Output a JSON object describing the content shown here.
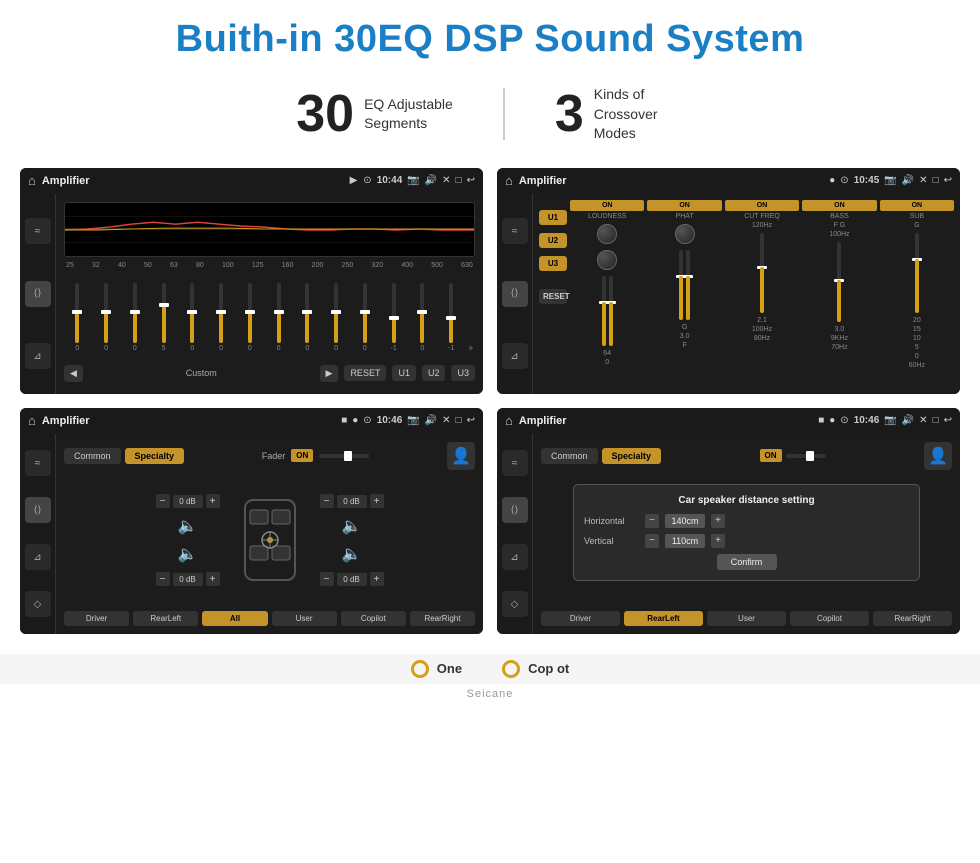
{
  "header": {
    "title": "Buith-in 30EQ DSP Sound System"
  },
  "stats": [
    {
      "number": "30",
      "label": "EQ Adjustable\nSegments"
    },
    {
      "number": "3",
      "label": "Kinds of\nCrossover Modes"
    }
  ],
  "screens": [
    {
      "id": "screen1",
      "topbar": {
        "title": "Amplifier",
        "time": "10:44"
      },
      "type": "eq",
      "freqs": [
        "25",
        "32",
        "40",
        "50",
        "63",
        "80",
        "100",
        "125",
        "160",
        "200",
        "250",
        "320",
        "400",
        "500",
        "630"
      ],
      "sliderVals": [
        "0",
        "0",
        "0",
        "5",
        "0",
        "0",
        "0",
        "0",
        "0",
        "0",
        "0",
        "-1",
        "0",
        "-1"
      ],
      "controls": [
        "Custom",
        "RESET",
        "U1",
        "U2",
        "U3"
      ]
    },
    {
      "id": "screen2",
      "topbar": {
        "title": "Amplifier",
        "time": "10:45"
      },
      "type": "crossover",
      "channels": [
        "U1",
        "U2",
        "U3"
      ],
      "cols": [
        {
          "label": "LOUDNESS",
          "on": true
        },
        {
          "label": "PHAT",
          "on": true
        },
        {
          "label": "CUT FREQ",
          "on": true
        },
        {
          "label": "BASS",
          "on": true
        },
        {
          "label": "SUB",
          "on": true
        }
      ]
    },
    {
      "id": "screen3",
      "topbar": {
        "title": "Amplifier",
        "time": "10:46"
      },
      "type": "speaker",
      "tabs": [
        "Common",
        "Specialty"
      ],
      "fader": {
        "label": "Fader",
        "on": true
      },
      "channels": [
        {
          "label": "Driver",
          "db": "0 dB"
        },
        {
          "label": "Copilot",
          "db": "0 dB"
        },
        {
          "label": "RearLeft",
          "db": "0 dB"
        },
        {
          "label": "RearRight",
          "db": "0 dB"
        }
      ],
      "bottomBtns": [
        "Driver",
        "All",
        "User",
        "Copilot",
        "RearLeft",
        "RearRight"
      ]
    },
    {
      "id": "screen4",
      "topbar": {
        "title": "Amplifier",
        "time": "10:46"
      },
      "type": "speaker-dialog",
      "tabs": [
        "Common",
        "Specialty"
      ],
      "dialog": {
        "title": "Car speaker distance setting",
        "rows": [
          {
            "label": "Horizontal",
            "value": "140cm"
          },
          {
            "label": "Vertical",
            "value": "110cm"
          }
        ],
        "confirm": "Confirm"
      },
      "bottomBtns": [
        "Driver",
        "RearLeft",
        "User",
        "Copilot",
        "RearRight"
      ]
    }
  ],
  "bottom": {
    "items": [
      {
        "text": "One"
      },
      {
        "text": "Cop ot"
      }
    ]
  },
  "watermark": "Seicane"
}
